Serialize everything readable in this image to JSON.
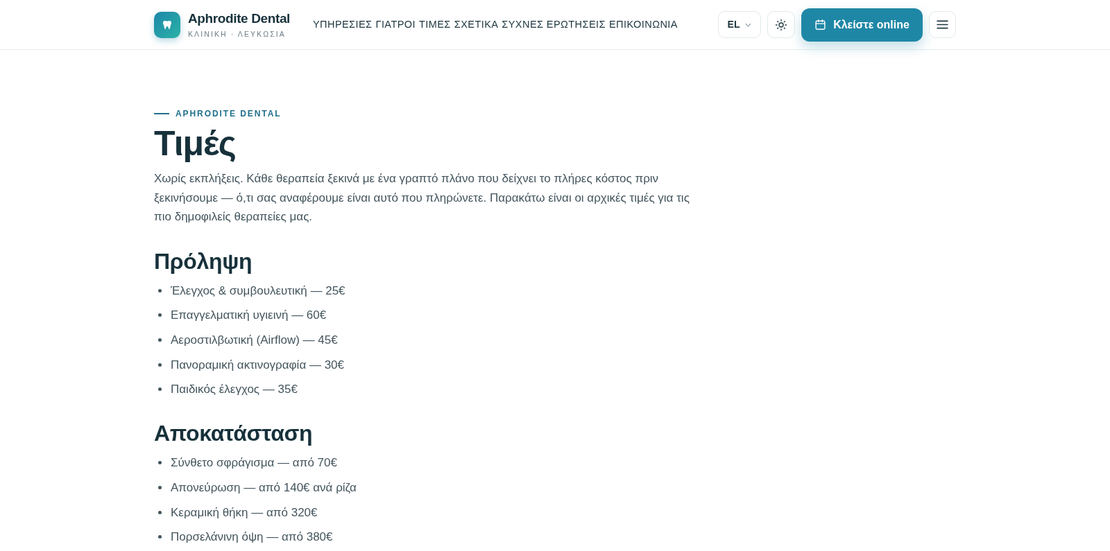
{
  "header": {
    "logo": {
      "name": "Aphrodite Dental",
      "tagline": "ΚΛΙΝΙΚΗ · ΛΕΥΚΩΣΙΑ"
    },
    "nav": [
      "ΥΠΗΡΕΣΙΕΣ",
      "ΓΙΑΤΡΟΙ",
      "ΤΙΜΕΣ",
      "ΣΧΕΤΙΚΑ",
      "ΣΥΧΝΕΣ ΕΡΩΤΗΣΕΙΣ",
      "ΕΠΙΚΟΙΝΩΝΙΑ"
    ],
    "language": "EL",
    "book_button": "Κλείστε online"
  },
  "page": {
    "eyebrow": "APHRODITE DENTAL",
    "title": "Τιμές",
    "intro": "Χωρίς εκπλήξεις. Κάθε θεραπεία ξεκινά με ένα γραπτό πλάνο που δείχνει το πλήρες κόστος πριν ξεκινήσουμε — ό,τι σας αναφέρουμε είναι αυτό που πληρώνετε. Παρακάτω είναι οι αρχικές τιμές για τις πιο δημοφιλείς θεραπείες μας.",
    "sections": [
      {
        "heading": "Πρόληψη",
        "items": [
          "Έλεγχος & συμβουλευτική — 25€",
          "Επαγγελματική υγιεινή — 60€",
          "Αεροστιλβωτική (Airflow) — 45€",
          "Πανοραμική ακτινογραφία — 30€",
          "Παιδικός έλεγχος — 35€"
        ]
      },
      {
        "heading": "Αποκατάσταση",
        "items": [
          "Σύνθετο σφράγισμα — από 70€",
          "Απονεύρωση — από 140€ ανά ρίζα",
          "Κεραμική θήκη — από 320€",
          "Πορσελάνινη όψη — από 380€"
        ]
      }
    ]
  }
}
